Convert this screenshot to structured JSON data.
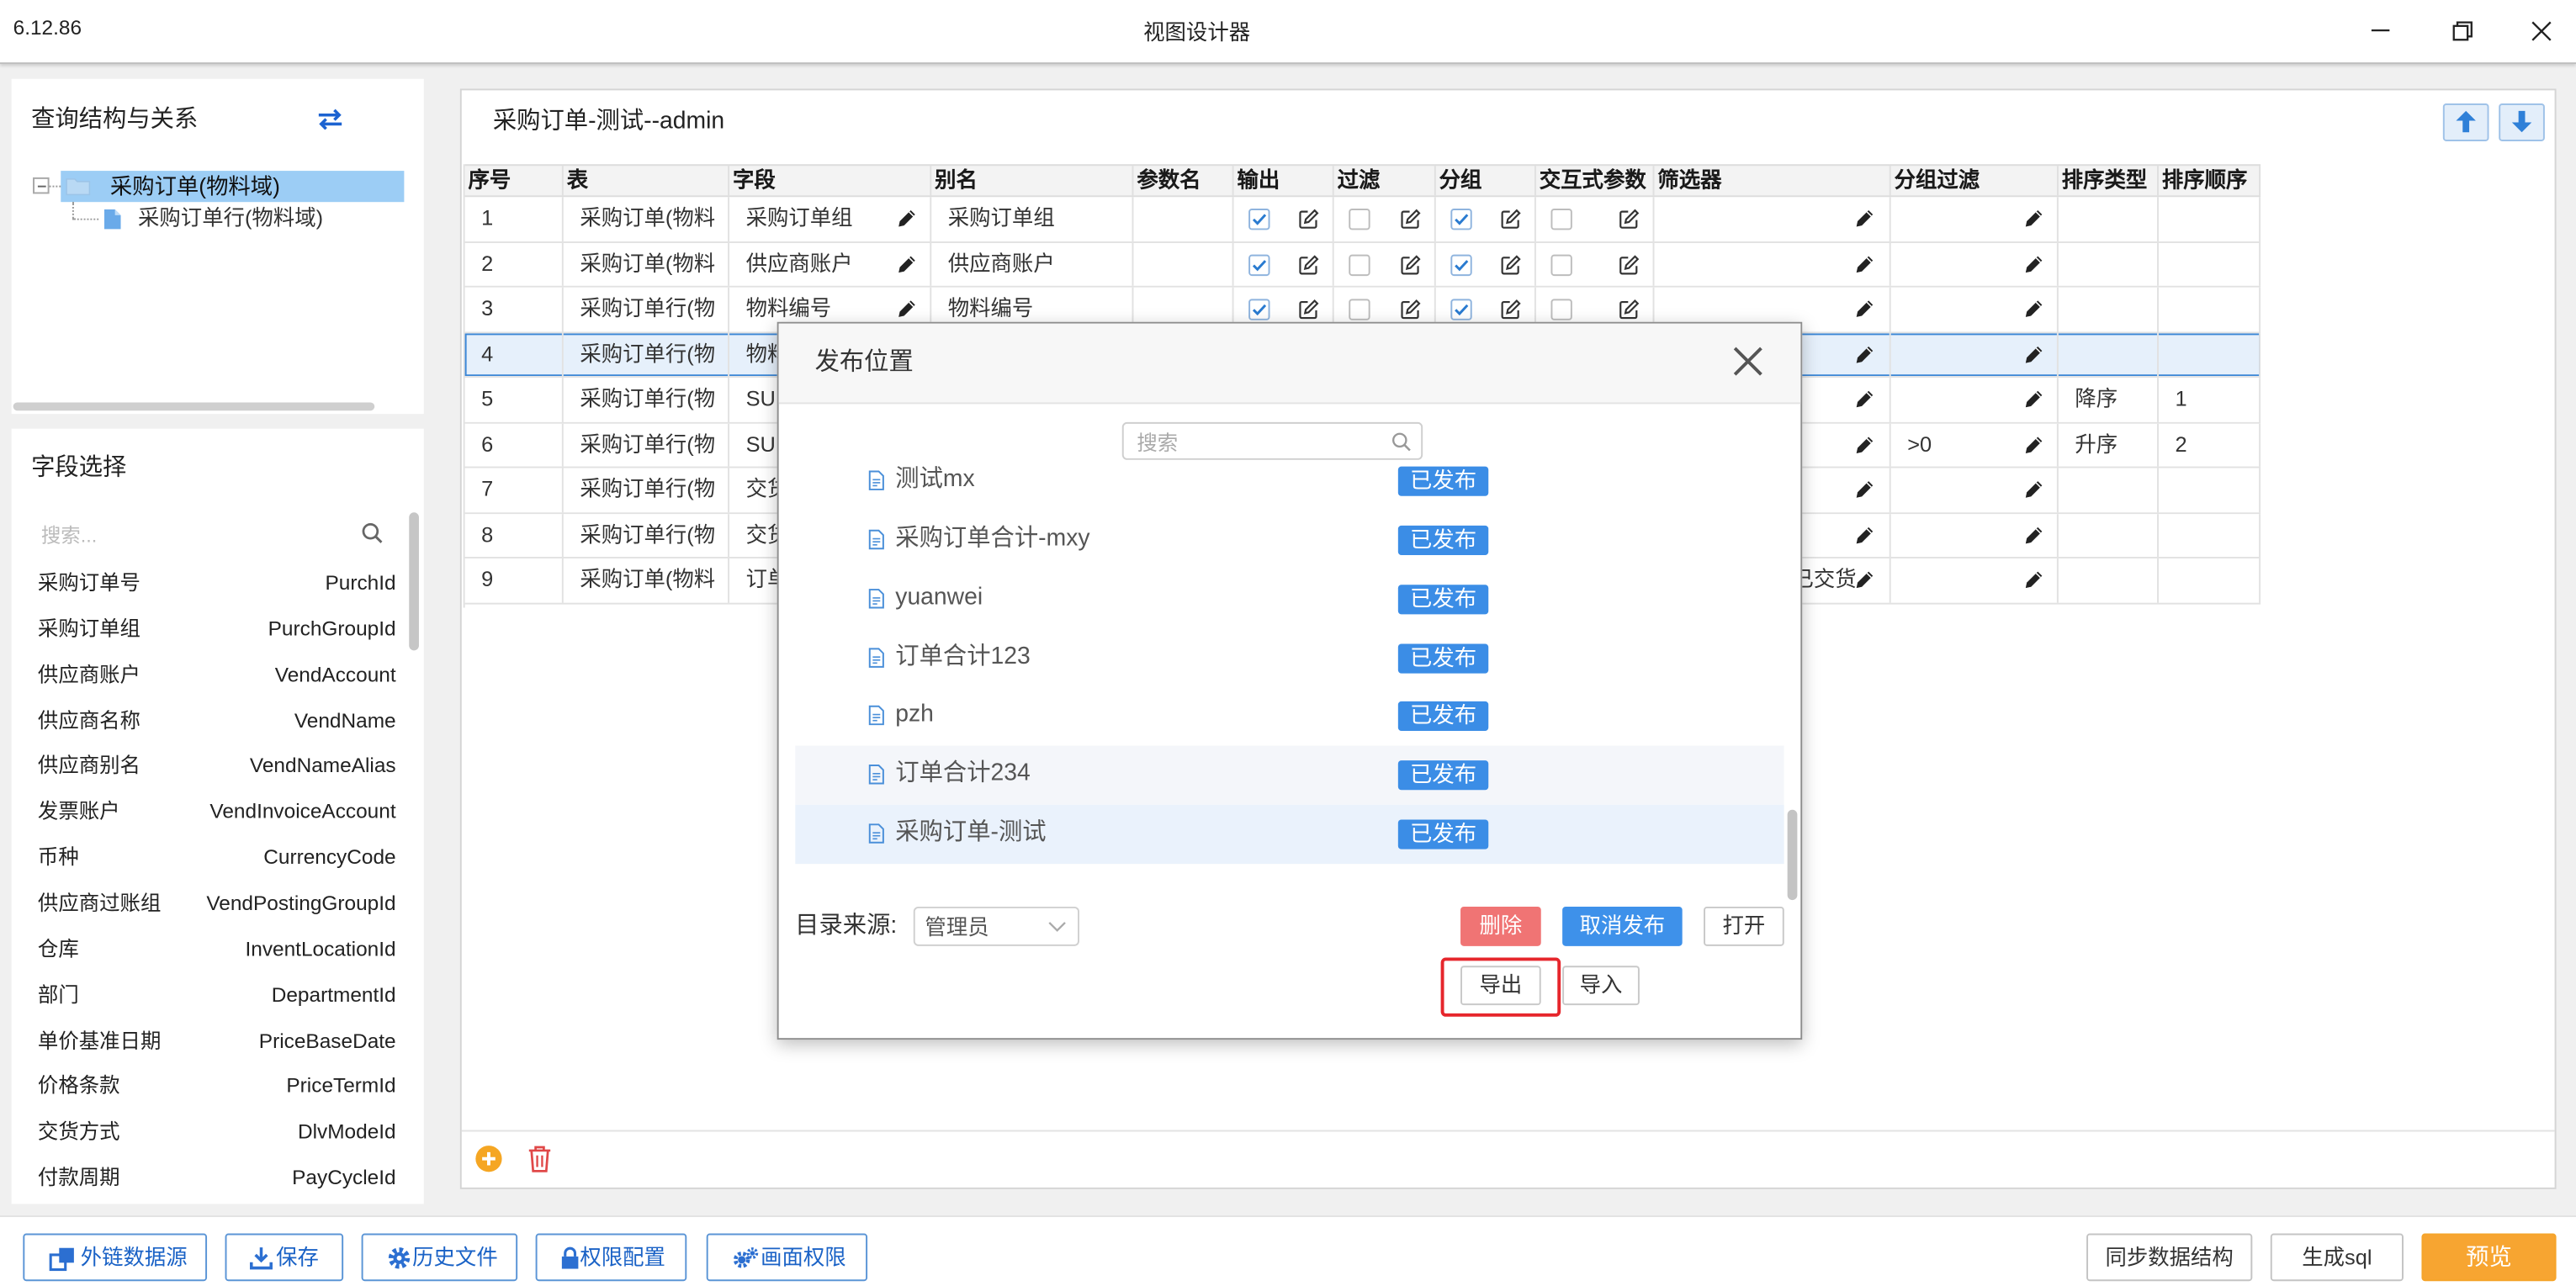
{
  "window": {
    "version": "6.12.86",
    "title": "视图设计器"
  },
  "relation_panel": {
    "title": "查询结构与关系",
    "tree": [
      {
        "label": "采购订单(物料域)",
        "selected": true
      },
      {
        "label": "采购订单行(物料域)"
      }
    ]
  },
  "field_panel": {
    "title": "字段选择",
    "search_placeholder": "搜索...",
    "items": [
      {
        "label": "采购订单号",
        "id": "PurchId"
      },
      {
        "label": "采购订单组",
        "id": "PurchGroupId"
      },
      {
        "label": "供应商账户",
        "id": "VendAccount"
      },
      {
        "label": "供应商名称",
        "id": "VendName"
      },
      {
        "label": "供应商别名",
        "id": "VendNameAlias"
      },
      {
        "label": "发票账户",
        "id": "VendInvoiceAccount"
      },
      {
        "label": "币种",
        "id": "CurrencyCode"
      },
      {
        "label": "供应商过账组",
        "id": "VendPostingGroupId"
      },
      {
        "label": "仓库",
        "id": "InventLocationId"
      },
      {
        "label": "部门",
        "id": "DepartmentId"
      },
      {
        "label": "单价基准日期",
        "id": "PriceBaseDate"
      },
      {
        "label": "价格条款",
        "id": "PriceTermId"
      },
      {
        "label": "交货方式",
        "id": "DlvModeId"
      },
      {
        "label": "付款周期",
        "id": "PayCycleId"
      }
    ]
  },
  "designer": {
    "title": "采购订单-测试--admin",
    "columns": [
      "序号",
      "表",
      "字段",
      "别名",
      "参数名",
      "输出",
      "过滤",
      "分组",
      "交互式参数",
      "筛选器",
      "分组过滤",
      "排序类型",
      "排序顺序"
    ],
    "rows": [
      {
        "no": "1",
        "table": "采购订单(物料",
        "field": "采购订单组",
        "alias": "采购订单组",
        "param": "",
        "output": true,
        "filter": false,
        "group": true,
        "interactive": false,
        "filter_value": "",
        "group_filter": "",
        "sort_type": "",
        "sort_order": ""
      },
      {
        "no": "2",
        "table": "采购订单(物料",
        "field": "供应商账户",
        "alias": "供应商账户",
        "param": "",
        "output": true,
        "filter": false,
        "group": true,
        "interactive": false,
        "filter_value": "",
        "group_filter": "",
        "sort_type": "",
        "sort_order": ""
      },
      {
        "no": "3",
        "table": "采购订单行(物",
        "field": "物料编号",
        "alias": "物料编号",
        "param": "",
        "output": true,
        "filter": false,
        "group": true,
        "interactive": false,
        "filter_value": "",
        "group_filter": "",
        "sort_type": "",
        "sort_order": ""
      },
      {
        "no": "4",
        "table": "采购订单行(物",
        "field": "物料",
        "alias": "",
        "param": "",
        "output": null,
        "filter": null,
        "group": null,
        "interactive": null,
        "filter_value": "",
        "group_filter": "",
        "sort_type": "",
        "sort_order": "",
        "selected": true
      },
      {
        "no": "5",
        "table": "采购订单行(物",
        "field": "SU",
        "alias": "",
        "param": "",
        "output": null,
        "filter": null,
        "group": null,
        "interactive": null,
        "filter_value": "",
        "group_filter": "",
        "sort_type": "降序",
        "sort_order": "1"
      },
      {
        "no": "6",
        "table": "采购订单行(物",
        "field": "SU",
        "alias": "",
        "param": "",
        "output": null,
        "filter": null,
        "group": null,
        "interactive": null,
        "filter_value": "",
        "group_filter": ">0",
        "sort_type": "升序",
        "sort_order": "2"
      },
      {
        "no": "7",
        "table": "采购订单行(物",
        "field": "交货",
        "alias": "",
        "param": "",
        "output": null,
        "filter": null,
        "group": null,
        "interactive": null,
        "filter_value": "",
        "group_filter": "",
        "sort_type": "",
        "sort_order": ""
      },
      {
        "no": "8",
        "table": "采购订单行(物",
        "field": "交货",
        "alias": "",
        "param": "",
        "output": null,
        "filter": null,
        "group": null,
        "interactive": null,
        "filter_value": "",
        "group_filter": "",
        "sort_type": "",
        "sort_order": ""
      },
      {
        "no": "9",
        "table": "采购订单(物料",
        "field": "订单",
        "alias": "",
        "param": "",
        "output": null,
        "filter": null,
        "group": null,
        "interactive": null,
        "filter_value": "已交货",
        "group_filter": "",
        "sort_type": "",
        "sort_order": ""
      }
    ]
  },
  "dialog": {
    "title": "发布位置",
    "search_placeholder": "搜索",
    "items": [
      {
        "name": "测试mx",
        "status": "已发布"
      },
      {
        "name": "采购订单合计-mxy",
        "status": "已发布"
      },
      {
        "name": "yuanwei",
        "status": "已发布"
      },
      {
        "name": "订单合计123",
        "status": "已发布"
      },
      {
        "name": "pzh",
        "status": "已发布"
      },
      {
        "name": "订单合计234",
        "status": "已发布",
        "state": "hover"
      },
      {
        "name": "采购订单-测试",
        "status": "已发布",
        "state": "selected"
      }
    ],
    "source_label": "目录来源:",
    "source_value": "管理员",
    "buttons": {
      "delete": "删除",
      "unpublish": "取消发布",
      "open": "打开",
      "export": "导出",
      "import": "导入"
    }
  },
  "toolbar": {
    "external_source": "外链数据源",
    "save": "保存",
    "history": "历史文件",
    "permissions": "权限配置",
    "screen_permissions": "画面权限",
    "sync_structure": "同步数据结构",
    "generate_sql": "生成sql",
    "preview": "预览"
  },
  "colors": {
    "accent": "#3b8de6",
    "preview": "#f7a531",
    "danger": "#f07474",
    "tree_selection": "#9ccdf5",
    "highlight": "#e6262c"
  }
}
